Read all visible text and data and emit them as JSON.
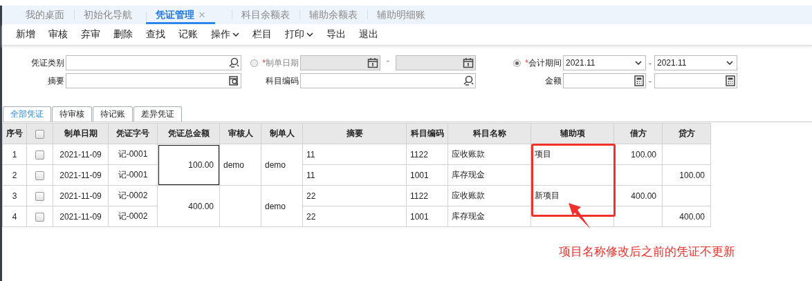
{
  "tabs": [
    {
      "label": "我的桌面",
      "selected": false,
      "closable": false
    },
    {
      "label": "初始化导航",
      "selected": false,
      "closable": false
    },
    {
      "label": "凭证管理",
      "selected": true,
      "closable": true,
      "close": "×"
    },
    {
      "label": "科目余额表",
      "selected": false,
      "closable": false
    },
    {
      "label": "辅助余额表",
      "selected": false,
      "closable": false
    },
    {
      "label": "辅助明细账",
      "selected": false,
      "closable": false
    }
  ],
  "toolbar": [
    {
      "label": "新增",
      "dropdown": false
    },
    {
      "label": "审核",
      "dropdown": false
    },
    {
      "label": "弃审",
      "dropdown": false
    },
    {
      "label": "删除",
      "dropdown": false
    },
    {
      "label": "查找",
      "dropdown": false
    },
    {
      "label": "记账",
      "dropdown": false
    },
    {
      "label": "操作",
      "dropdown": true
    },
    {
      "label": "栏目",
      "dropdown": false
    },
    {
      "label": "打印",
      "dropdown": true
    },
    {
      "label": "导出",
      "dropdown": false
    },
    {
      "label": "退出",
      "dropdown": false
    }
  ],
  "filters": {
    "voucher_type": {
      "label": "凭证类别"
    },
    "summary": {
      "label": "摘要"
    },
    "date_range": {
      "required": "*",
      "label": "制单日期",
      "selected": false,
      "separator": "-"
    },
    "account_code": {
      "label": "科目编码"
    },
    "period": {
      "required": "*",
      "label": "会计期间",
      "selected": true,
      "from": "2021.11",
      "to": "2021.11",
      "separator": "-"
    },
    "amount": {
      "label": "金额",
      "separator": "-"
    }
  },
  "status_tabs": [
    {
      "label": "全部凭证",
      "selected": true
    },
    {
      "label": "待审核",
      "selected": false
    },
    {
      "label": "待记账",
      "selected": false
    },
    {
      "label": "差异凭证",
      "selected": false
    }
  ],
  "table": {
    "columns": [
      "序号",
      "",
      "制单日期",
      "凭证字号",
      "凭证总金额",
      "审核人",
      "制单人",
      "摘要",
      "科目编码",
      "科目名称",
      "辅助项",
      "借方",
      "贷方"
    ],
    "vouchers": [
      {
        "total": "100.00",
        "focused": true,
        "reviewer": "demo",
        "maker": "demo",
        "lines": [
          {
            "no": "1",
            "checked": false,
            "date": "2021-11-09",
            "voucher_no": "记-0001",
            "summary": "11",
            "code": "1122",
            "name": "应收账款",
            "aux": "项目",
            "debit": "100.00"
          },
          {
            "no": "2",
            "checked": false,
            "date": "2021-11-09",
            "voucher_no": "记-0001",
            "summary": "11",
            "code": "1001",
            "name": "库存现金",
            "credit": "100.00"
          }
        ]
      },
      {
        "total": "400.00",
        "focused": false,
        "maker": "demo",
        "lines": [
          {
            "no": "3",
            "checked": false,
            "date": "2021-11-09",
            "voucher_no": "记-0002",
            "summary": "22",
            "code": "1122",
            "name": "应收账款",
            "aux": "新项目",
            "debit": "400.00"
          },
          {
            "no": "4",
            "checked": false,
            "date": "2021-11-09",
            "voucher_no": "记-0002",
            "summary": "22",
            "code": "1001",
            "name": "库存现金",
            "credit": "400.00"
          }
        ]
      }
    ],
    "select_all_checked": false
  },
  "annotation": {
    "text": "项目名称修改后之前的凭证不更新"
  }
}
